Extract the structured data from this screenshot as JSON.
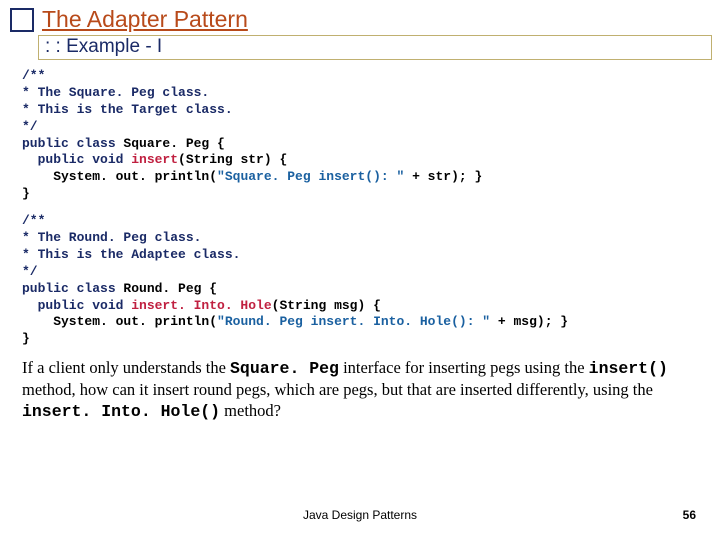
{
  "title": "The Adapter Pattern",
  "subtitle": ": : Example - I",
  "code1": {
    "c1": "/**",
    "c2": "* The Square. Peg class.",
    "c3": "* This is the Target class.",
    "c4": "*/",
    "l1a": "public class ",
    "l1b": "Square. Peg {",
    "l2a": "  public void ",
    "l2b": "insert",
    "l2c": "(String str) {",
    "l3a": "    System. out. println(",
    "l3b": "\"Square. Peg insert(): \"",
    "l3c": " + str); }",
    "l4": "}"
  },
  "code2": {
    "c1": "/**",
    "c2": "* The Round. Peg class.",
    "c3": "* This is the Adaptee class.",
    "c4": "*/",
    "l1a": "public class ",
    "l1b": "Round. Peg {",
    "l2a": "  public void ",
    "l2b": "insert. Into. Hole",
    "l2c": "(String msg) {",
    "l3a": "    System. out. println(",
    "l3b": "\"Round. Peg insert. Into. Hole(): \"",
    "l3c": " + msg); }",
    "l4": "}"
  },
  "para": {
    "t1": "If a client only understands the ",
    "m1": "Square. Peg",
    "t2": " interface for inserting pegs using the ",
    "m2": "insert()",
    "t3": "  method, how can it insert round pegs, which are pegs, but that are inserted differently, using the ",
    "m3": "insert. Into. Hole()",
    "t4": " method?"
  },
  "footer": "Java Design Patterns",
  "pagenum": "56"
}
